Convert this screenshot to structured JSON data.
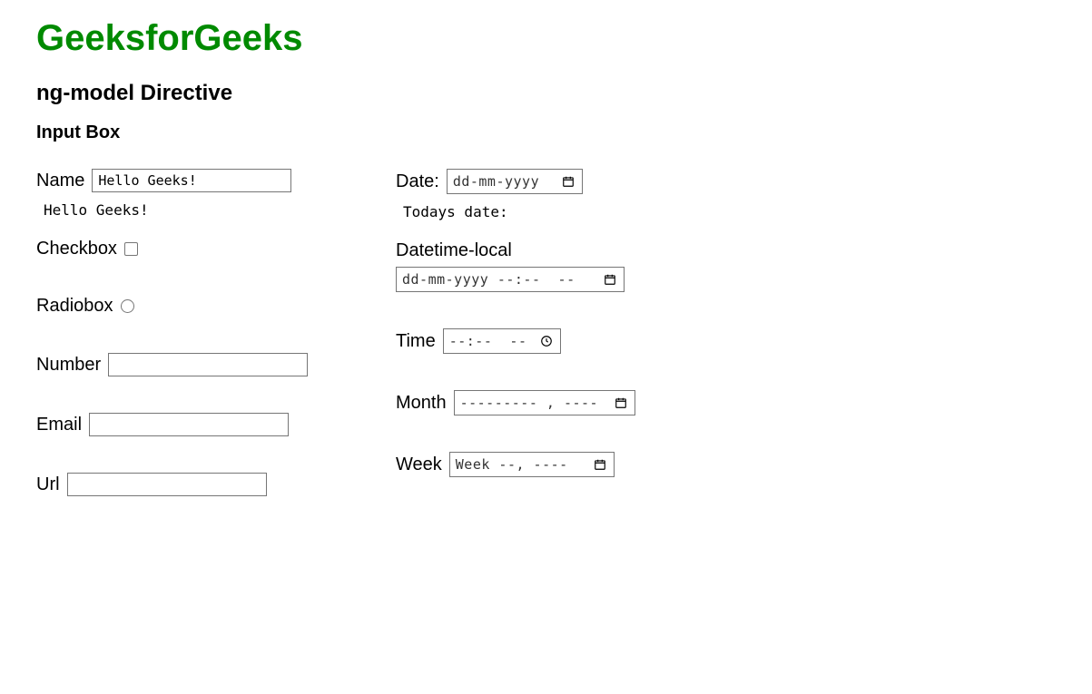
{
  "header": {
    "title": "GeeksforGeeks",
    "subtitle": "ng-model Directive",
    "section": "Input Box"
  },
  "left": {
    "name_label": "Name",
    "name_value": "Hello Geeks!",
    "echo_text": "Hello Geeks!",
    "checkbox_label": "Checkbox",
    "radio_label": "Radiobox",
    "number_label": "Number",
    "email_label": "Email",
    "url_label": "Url"
  },
  "right": {
    "date_label": "Date:",
    "date_placeholder": "dd-mm-yyyy",
    "date_echo": "Todays date:",
    "datetime_label": "Datetime-local",
    "datetime_placeholder": "dd-mm-yyyy --:--  --",
    "time_label": "Time",
    "time_placeholder": "--:--  --",
    "month_label": "Month",
    "month_placeholder": "--------- , ----",
    "week_label": "Week",
    "week_placeholder": "Week --, ----"
  }
}
